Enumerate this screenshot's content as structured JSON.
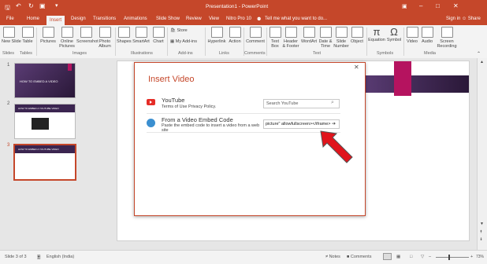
{
  "window": {
    "title": "Presentation1 - PowerPoint",
    "tell_me": "Tell me what you want to do...",
    "sign_in": "Sign in",
    "share": "Share"
  },
  "tabs": [
    "File",
    "Home",
    "Insert",
    "Design",
    "Transitions",
    "Animations",
    "Slide Show",
    "Review",
    "View",
    "Nitro Pro 10"
  ],
  "active_tab": "Insert",
  "ribbon": {
    "buttons": [
      "New Slide",
      "Table",
      "Pictures",
      "Online Pictures",
      "Screenshot",
      "Photo Album",
      "Shapes",
      "SmartArt",
      "Chart",
      "Store",
      "My Add-ins",
      "Hyperlink",
      "Action",
      "Comment",
      "Text Box",
      "Header & Footer",
      "WordArt",
      "Date & Time",
      "Slide Number",
      "Object",
      "Equation",
      "Symbol",
      "Video",
      "Audio",
      "Screen Recording"
    ],
    "groups": [
      "Slides",
      "Tables",
      "Images",
      "Illustrations",
      "Add-ins",
      "Links",
      "Comments",
      "Text",
      "Symbols",
      "Media"
    ]
  },
  "slides": {
    "items": [
      {
        "num": "1",
        "text": "HOW TO EMBED A VIDEO"
      },
      {
        "num": "2",
        "text": "HOW TO EMBED A YOUTUBE VIDEO"
      },
      {
        "num": "3",
        "text": "HOW TO EMBED A YOUTUBE VIDEO"
      }
    ]
  },
  "dialog": {
    "title": "Insert Video",
    "youtube": {
      "name": "YouTube",
      "terms": "Terms of Use",
      "privacy": "Privacy Policy.",
      "placeholder": "Search YouTube"
    },
    "embed": {
      "name": "From a Video Embed Code",
      "desc": "Paste the embed code to insert a video from a web site",
      "value": "picture\" allowfullscreen></iframe>"
    }
  },
  "status": {
    "slide": "Slide 3 of 3",
    "language": "English (India)",
    "notes": "Notes",
    "comments": "Comments",
    "zoom": "73%"
  },
  "colors": {
    "accent": "#c5472a",
    "slide_band": "#3b2550",
    "magenta": "#b5135f",
    "arrow": "#e0141c"
  }
}
